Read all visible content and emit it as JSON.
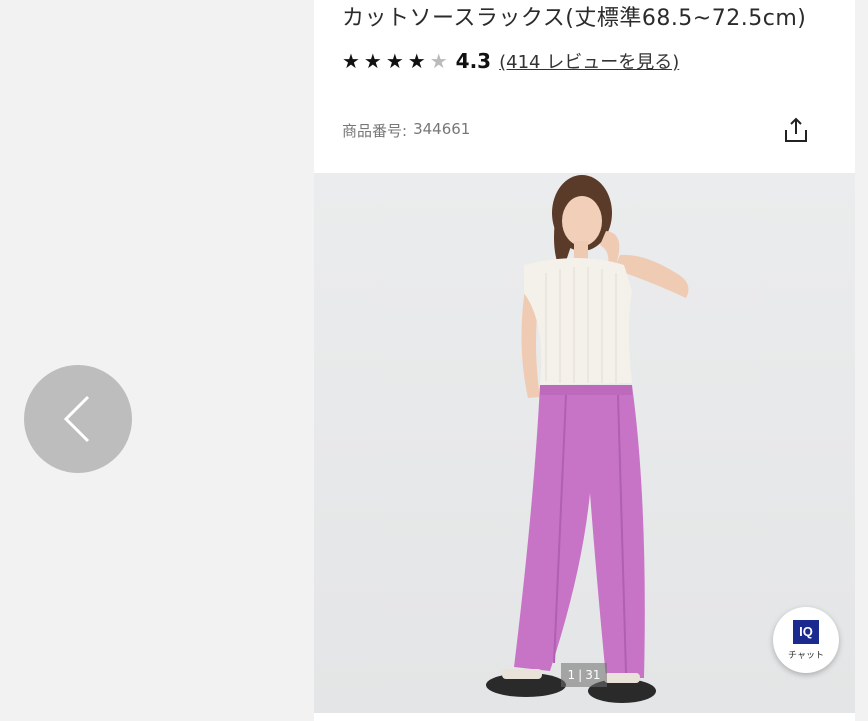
{
  "product": {
    "title": "カットソースラックス(丈標準68.5~72.5cm)",
    "stars": "★★★★",
    "half_star": "★",
    "rating": "4.3",
    "review_link": "(414 レビューを見る)",
    "product_number_label": "商品番号:",
    "product_number": "344661"
  },
  "gallery": {
    "current": "1",
    "separator": "|",
    "total": "31"
  },
  "chat": {
    "badge": "IQ",
    "label": "チャット"
  },
  "icons": {
    "back": "chevron-left-icon",
    "share": "share-icon"
  },
  "colors": {
    "accent": "#1b2a8f",
    "pants": "#c774c6"
  }
}
